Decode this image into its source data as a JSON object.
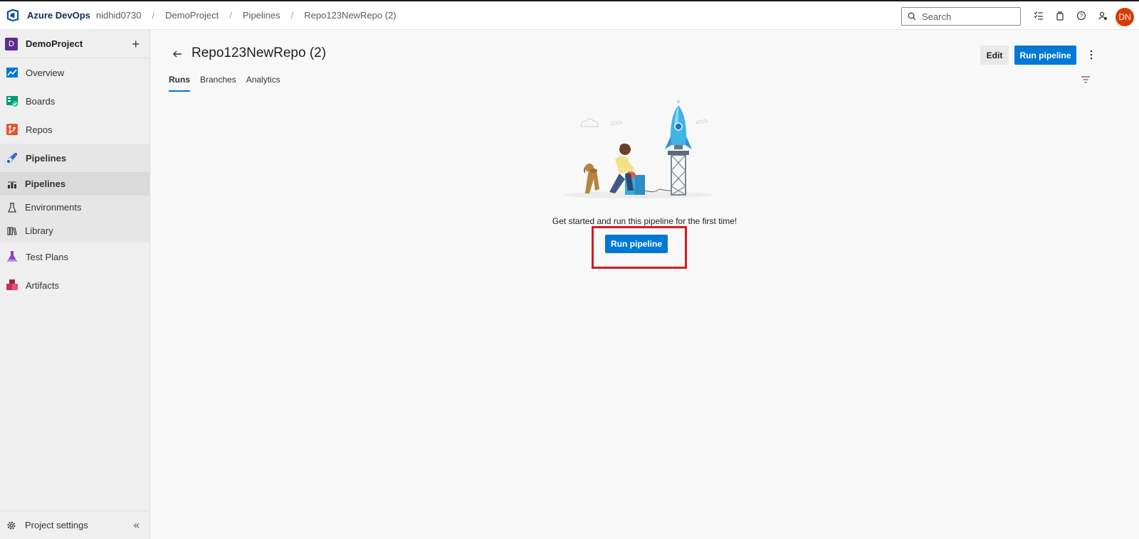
{
  "brand": {
    "name": "Azure DevOps"
  },
  "breadcrumbs": [
    "nidhid0730",
    "DemoProject",
    "Pipelines",
    "Repo123NewRepo (2)"
  ],
  "search": {
    "placeholder": "Search"
  },
  "user": {
    "initials": "DN",
    "avatar_color": "#d83b01"
  },
  "sidebar": {
    "project": {
      "badge": "D",
      "name": "DemoProject"
    },
    "items": [
      {
        "label": "Overview",
        "icon": "overview-icon"
      },
      {
        "label": "Boards",
        "icon": "boards-icon"
      },
      {
        "label": "Repos",
        "icon": "repos-icon"
      },
      {
        "label": "Pipelines",
        "icon": "pipelines-icon"
      },
      {
        "label": "Test Plans",
        "icon": "test-plans-icon"
      },
      {
        "label": "Artifacts",
        "icon": "artifacts-icon"
      }
    ],
    "pipelines_sub": [
      {
        "label": "Pipelines",
        "active": true
      },
      {
        "label": "Environments",
        "active": false
      },
      {
        "label": "Library",
        "active": false
      }
    ],
    "settings_label": "Project settings"
  },
  "page": {
    "title": "Repo123NewRepo (2)",
    "edit_label": "Edit",
    "run_label": "Run pipeline",
    "tabs": [
      "Runs",
      "Branches",
      "Analytics"
    ],
    "empty_message": "Get started and run this pipeline for the first time!",
    "empty_run_label": "Run pipeline"
  },
  "colors": {
    "accent": "#0078d4",
    "highlight": "#d71920"
  }
}
